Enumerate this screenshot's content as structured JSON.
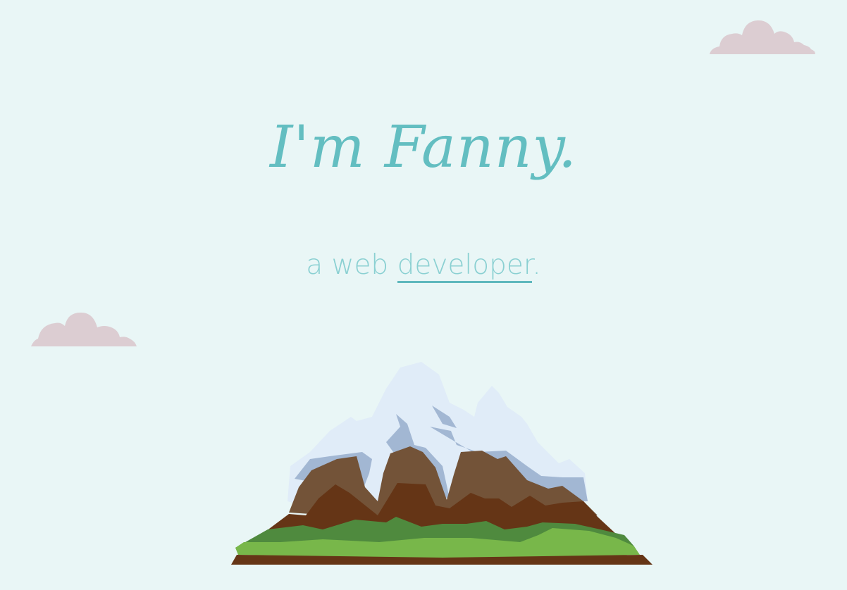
{
  "hero": {
    "title": "I'm Fanny.",
    "subtitle_prefix": "a web ",
    "subtitle_link": "developer",
    "subtitle_suffix": "."
  },
  "colors": {
    "background": "#e9f6f6",
    "title": "#63bec1",
    "subtitle": "#8ad0d2",
    "underline": "#5fb8bd",
    "cloud": "#dccdd2"
  },
  "decorations": {
    "clouds": [
      "cloud-icon",
      "cloud-icon"
    ],
    "illustration": "mountain-illustration"
  }
}
